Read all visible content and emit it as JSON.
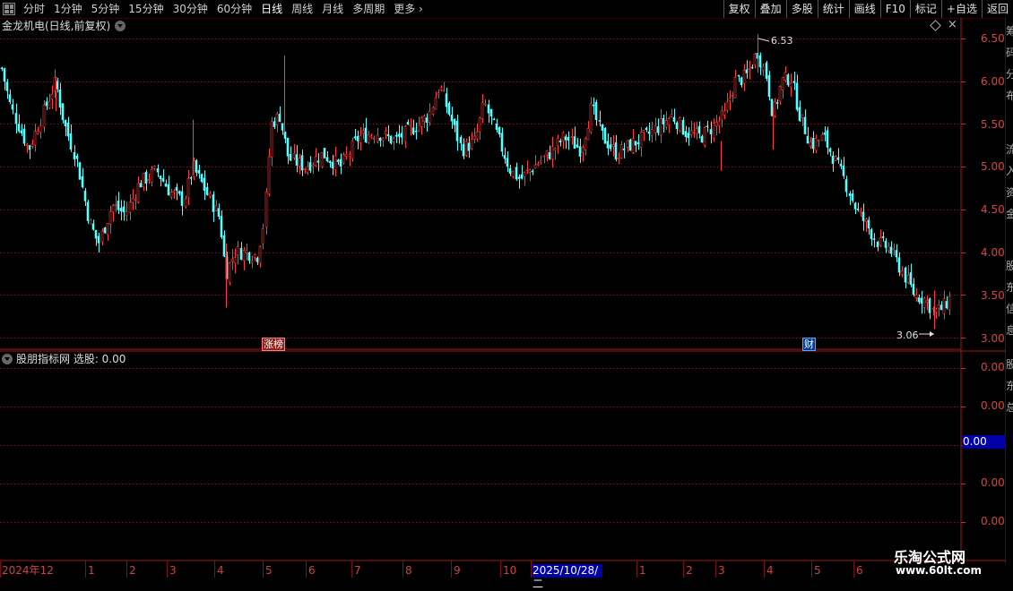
{
  "toolbar": {
    "periods": [
      "分时",
      "1分钟",
      "5分钟",
      "15分钟",
      "30分钟",
      "60分钟",
      "日线",
      "周线",
      "月线",
      "多周期",
      "更多"
    ],
    "active_period": "日线",
    "buttons": [
      "复权",
      "叠加",
      "多股",
      "统计",
      "画线",
      "F10",
      "标记",
      "+自选",
      "返回"
    ]
  },
  "chart": {
    "title": "金龙机电(日线,前复权)",
    "price_axis": [
      "6.50",
      "6.00",
      "5.50",
      "5.00",
      "4.50",
      "4.00",
      "3.50",
      "3.00"
    ],
    "high_label": "6.53",
    "low_label": "3.06",
    "markers": {
      "limit_up_list": "涨榜",
      "finance": "财"
    }
  },
  "indicator": {
    "title": "股朋指标网 选股: 0.00",
    "axis": [
      "0.00",
      "0.00",
      "0.00",
      "0.00",
      "0.00"
    ],
    "cursor_value": "0.00"
  },
  "date_axis": {
    "labels": [
      "2024年12",
      "1",
      "2",
      "3",
      "4",
      "5",
      "6",
      "7",
      "8",
      "9",
      "10",
      "1",
      "2",
      "3",
      "4",
      "5",
      "6"
    ],
    "highlight": "2025/10/28/二"
  },
  "right_strip": {
    "chars": [
      "筹",
      "码",
      "分",
      "布",
      "流",
      "入",
      "资",
      "金",
      "股",
      "东",
      "信",
      "息",
      "股",
      "东",
      "总"
    ]
  },
  "watermark": {
    "title": "乐淘公式网",
    "url": "www.60lt.com"
  },
  "colors": {
    "up": "#ff3c3c",
    "down": "#54ffff",
    "grid": "#8a1a1a",
    "axis_text": "#e04040",
    "highlight_bg": "#0000a8"
  }
}
